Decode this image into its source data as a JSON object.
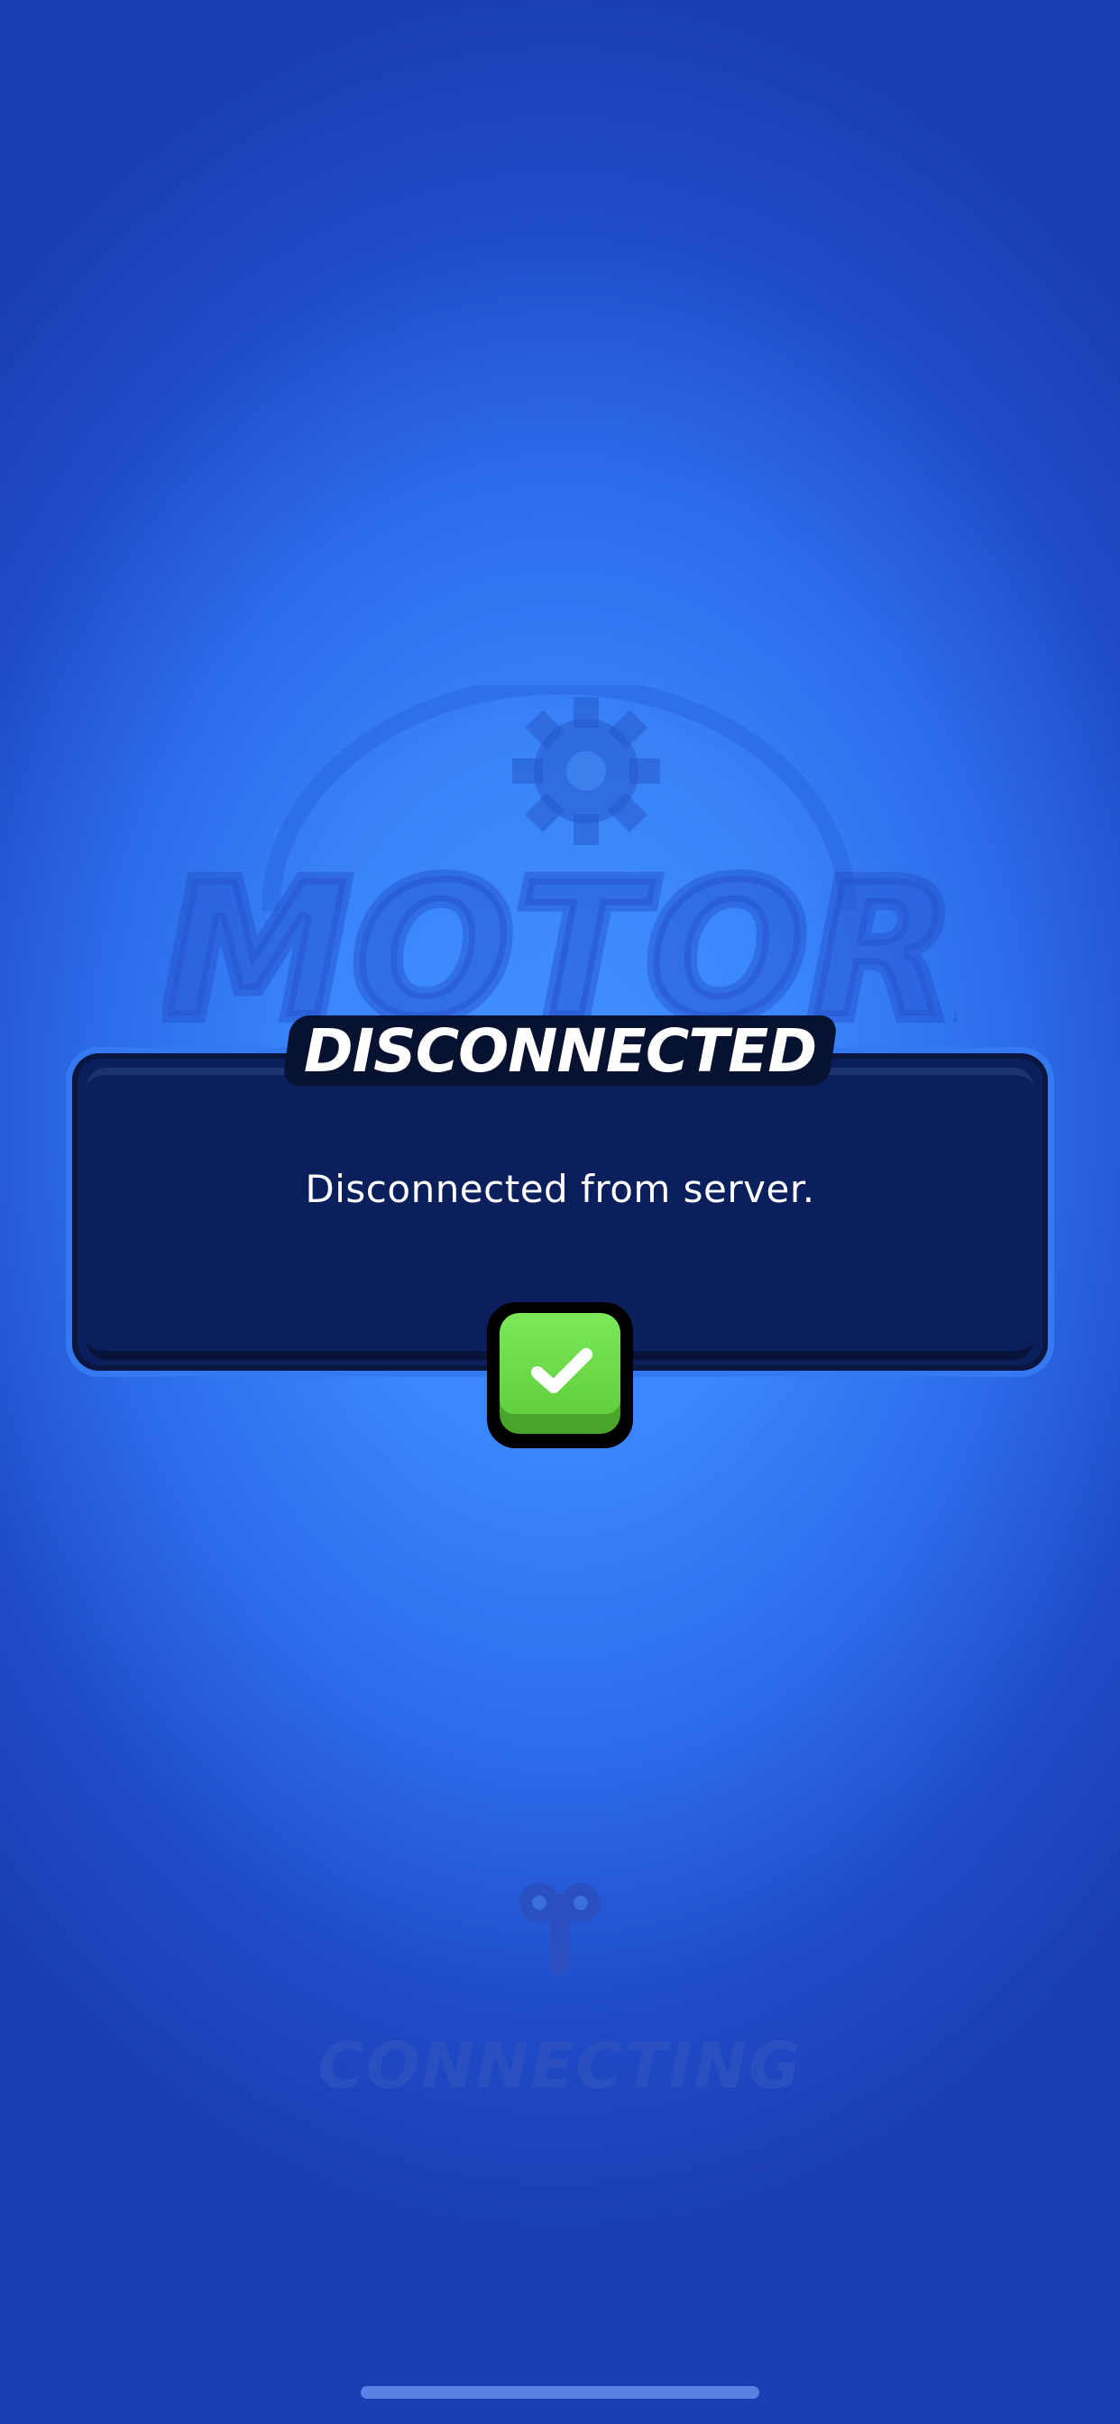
{
  "background_logo": {
    "word": "MOTORBALL"
  },
  "dialog": {
    "title": "DISCONNECTED",
    "message": "Disconnected from server.",
    "ok_icon": "checkmark-icon"
  },
  "status": {
    "text": "CONNECTING",
    "icon": "wind-up-key-icon"
  },
  "colors": {
    "dialog_bg": "#0a1f5c",
    "dialog_outline": "#3579f0",
    "ok_green": "#62cf3f",
    "background_center": "#4190ff",
    "background_edge": "#1a3eb4"
  }
}
